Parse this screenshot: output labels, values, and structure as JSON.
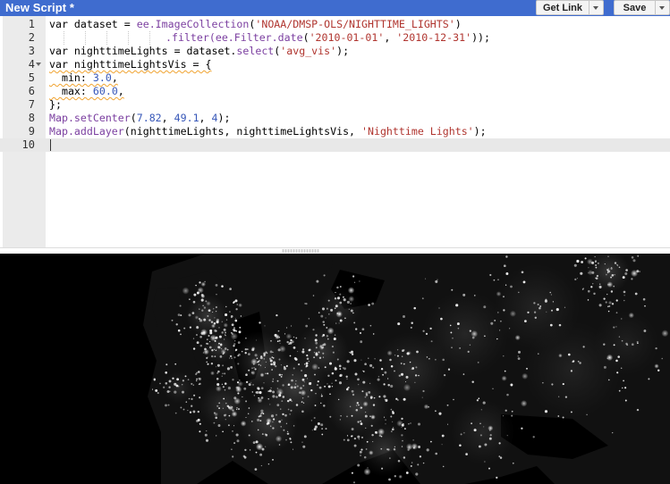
{
  "header": {
    "title": "New Script *",
    "get_link_label": "Get Link",
    "save_label": "Save",
    "accent_color": "#3f6ccf"
  },
  "editor": {
    "line_numbers": [
      "1",
      "2",
      "3",
      "4",
      "5",
      "6",
      "7",
      "8",
      "9",
      "10"
    ],
    "lines": [
      {
        "tokens": [
          "var dataset = ",
          "ee.ImageCollection",
          "(",
          "'NOAA/DMSP-OLS/NIGHTTIME_LIGHTS'",
          ")"
        ]
      },
      {
        "tokens": [
          ".filter(",
          "ee.Filter.date",
          "(",
          "'2010-01-01'",
          ", ",
          "'2010-12-31'",
          "));"
        ]
      },
      {
        "tokens": [
          "var nighttimeLights = dataset.",
          "select",
          "(",
          "'avg_vis'",
          ");"
        ]
      },
      {
        "tokens": [
          "var nighttimeLightsVis = {"
        ]
      },
      {
        "tokens": [
          "  min: ",
          "3.0",
          ","
        ]
      },
      {
        "tokens": [
          "  max: ",
          "60.0",
          ","
        ]
      },
      {
        "tokens": [
          "};"
        ]
      },
      {
        "tokens": [
          "Map.setCenter",
          "(",
          "7.82",
          ", ",
          "49.1",
          ", ",
          "4",
          ");"
        ]
      },
      {
        "tokens": [
          "Map.addLayer",
          "(nighttimeLights, nighttimeLightsVis, ",
          "'Nighttime Lights'",
          ");"
        ]
      },
      {
        "tokens": [
          ""
        ]
      }
    ],
    "active_line": "10",
    "colors": {
      "keyword_call": "#7b3fa0",
      "number": "#3757b8",
      "string": "#b0352f",
      "lint_warning": "#f0a330"
    }
  },
  "map": {
    "layer_name": "Nighttime Lights",
    "background": "#000000"
  }
}
